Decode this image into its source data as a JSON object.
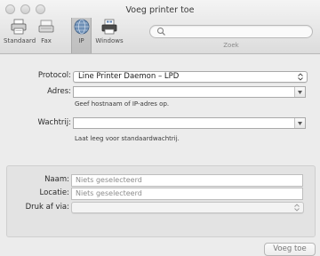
{
  "window": {
    "title": "Voeg printer toe"
  },
  "toolbar": {
    "items": [
      {
        "label": "Standaard",
        "icon": "printer-default-icon"
      },
      {
        "label": "Fax",
        "icon": "fax-icon"
      },
      {
        "label": "IP",
        "icon": "globe-icon"
      },
      {
        "label": "Windows",
        "icon": "windows-printer-icon"
      }
    ],
    "selected": "IP",
    "search": {
      "placeholder": "",
      "value": "",
      "label": "Zoek"
    }
  },
  "form": {
    "protocol": {
      "label": "Protocol:",
      "value": "Line Printer Daemon – LPD"
    },
    "address": {
      "label": "Adres:",
      "value": "",
      "hint": "Geef hostnaam of IP-adres op."
    },
    "queue": {
      "label": "Wachtrij:",
      "value": "",
      "hint": "Laat leeg voor standaardwachtrij."
    }
  },
  "details": {
    "name": {
      "label": "Naam:",
      "value": "Niets geselecteerd"
    },
    "location": {
      "label": "Locatie:",
      "value": "Niets geselecteerd"
    },
    "driver": {
      "label": "Druk af via:",
      "value": ""
    }
  },
  "actions": {
    "add_label": "Voeg toe"
  }
}
